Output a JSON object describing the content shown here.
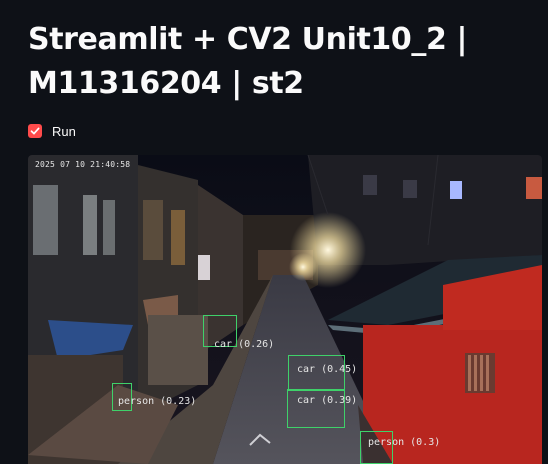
{
  "page": {
    "title_line1": "Streamlit + CV2 Unit10_2 |",
    "title_line2": "M11316204 | st2"
  },
  "run_checkbox": {
    "label": "Run",
    "checked": true,
    "accent": "#ff4b4b"
  },
  "video": {
    "timestamp": "2025 07 10 21:40:58",
    "box_color": "#3fd16a",
    "detections": [
      {
        "label": "car (0.26)"
      },
      {
        "label": "car (0.45)"
      },
      {
        "label": "car (0.39)"
      },
      {
        "label": "person (0.23)"
      },
      {
        "label": "person (0.3)"
      }
    ]
  }
}
